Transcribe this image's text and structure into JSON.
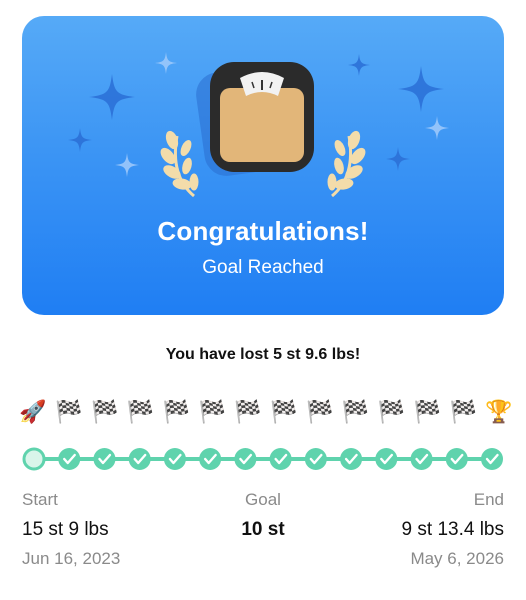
{
  "banner": {
    "title": "Congratulations!",
    "subtitle": "Goal Reached",
    "icon": "scale-icon",
    "bg_top": "#56aaf7",
    "bg_bottom": "#1f7ef3"
  },
  "summary": "You have lost 5 st 9.6 lbs!",
  "progress": {
    "start_icon": "rocket-icon",
    "milestone_icon": "checkered-flag-icon",
    "end_icon": "trophy-icon",
    "milestones": 12,
    "completed_checks": 12,
    "accent": "#5fd3ad"
  },
  "stats": {
    "start_label": "Start",
    "start_value": "15 st 9 lbs",
    "start_date": "Jun 16, 2023",
    "goal_label": "Goal",
    "goal_value": "10 st",
    "end_label": "End",
    "end_value": "9 st 13.4 lbs",
    "end_date": "May 6, 2026"
  }
}
